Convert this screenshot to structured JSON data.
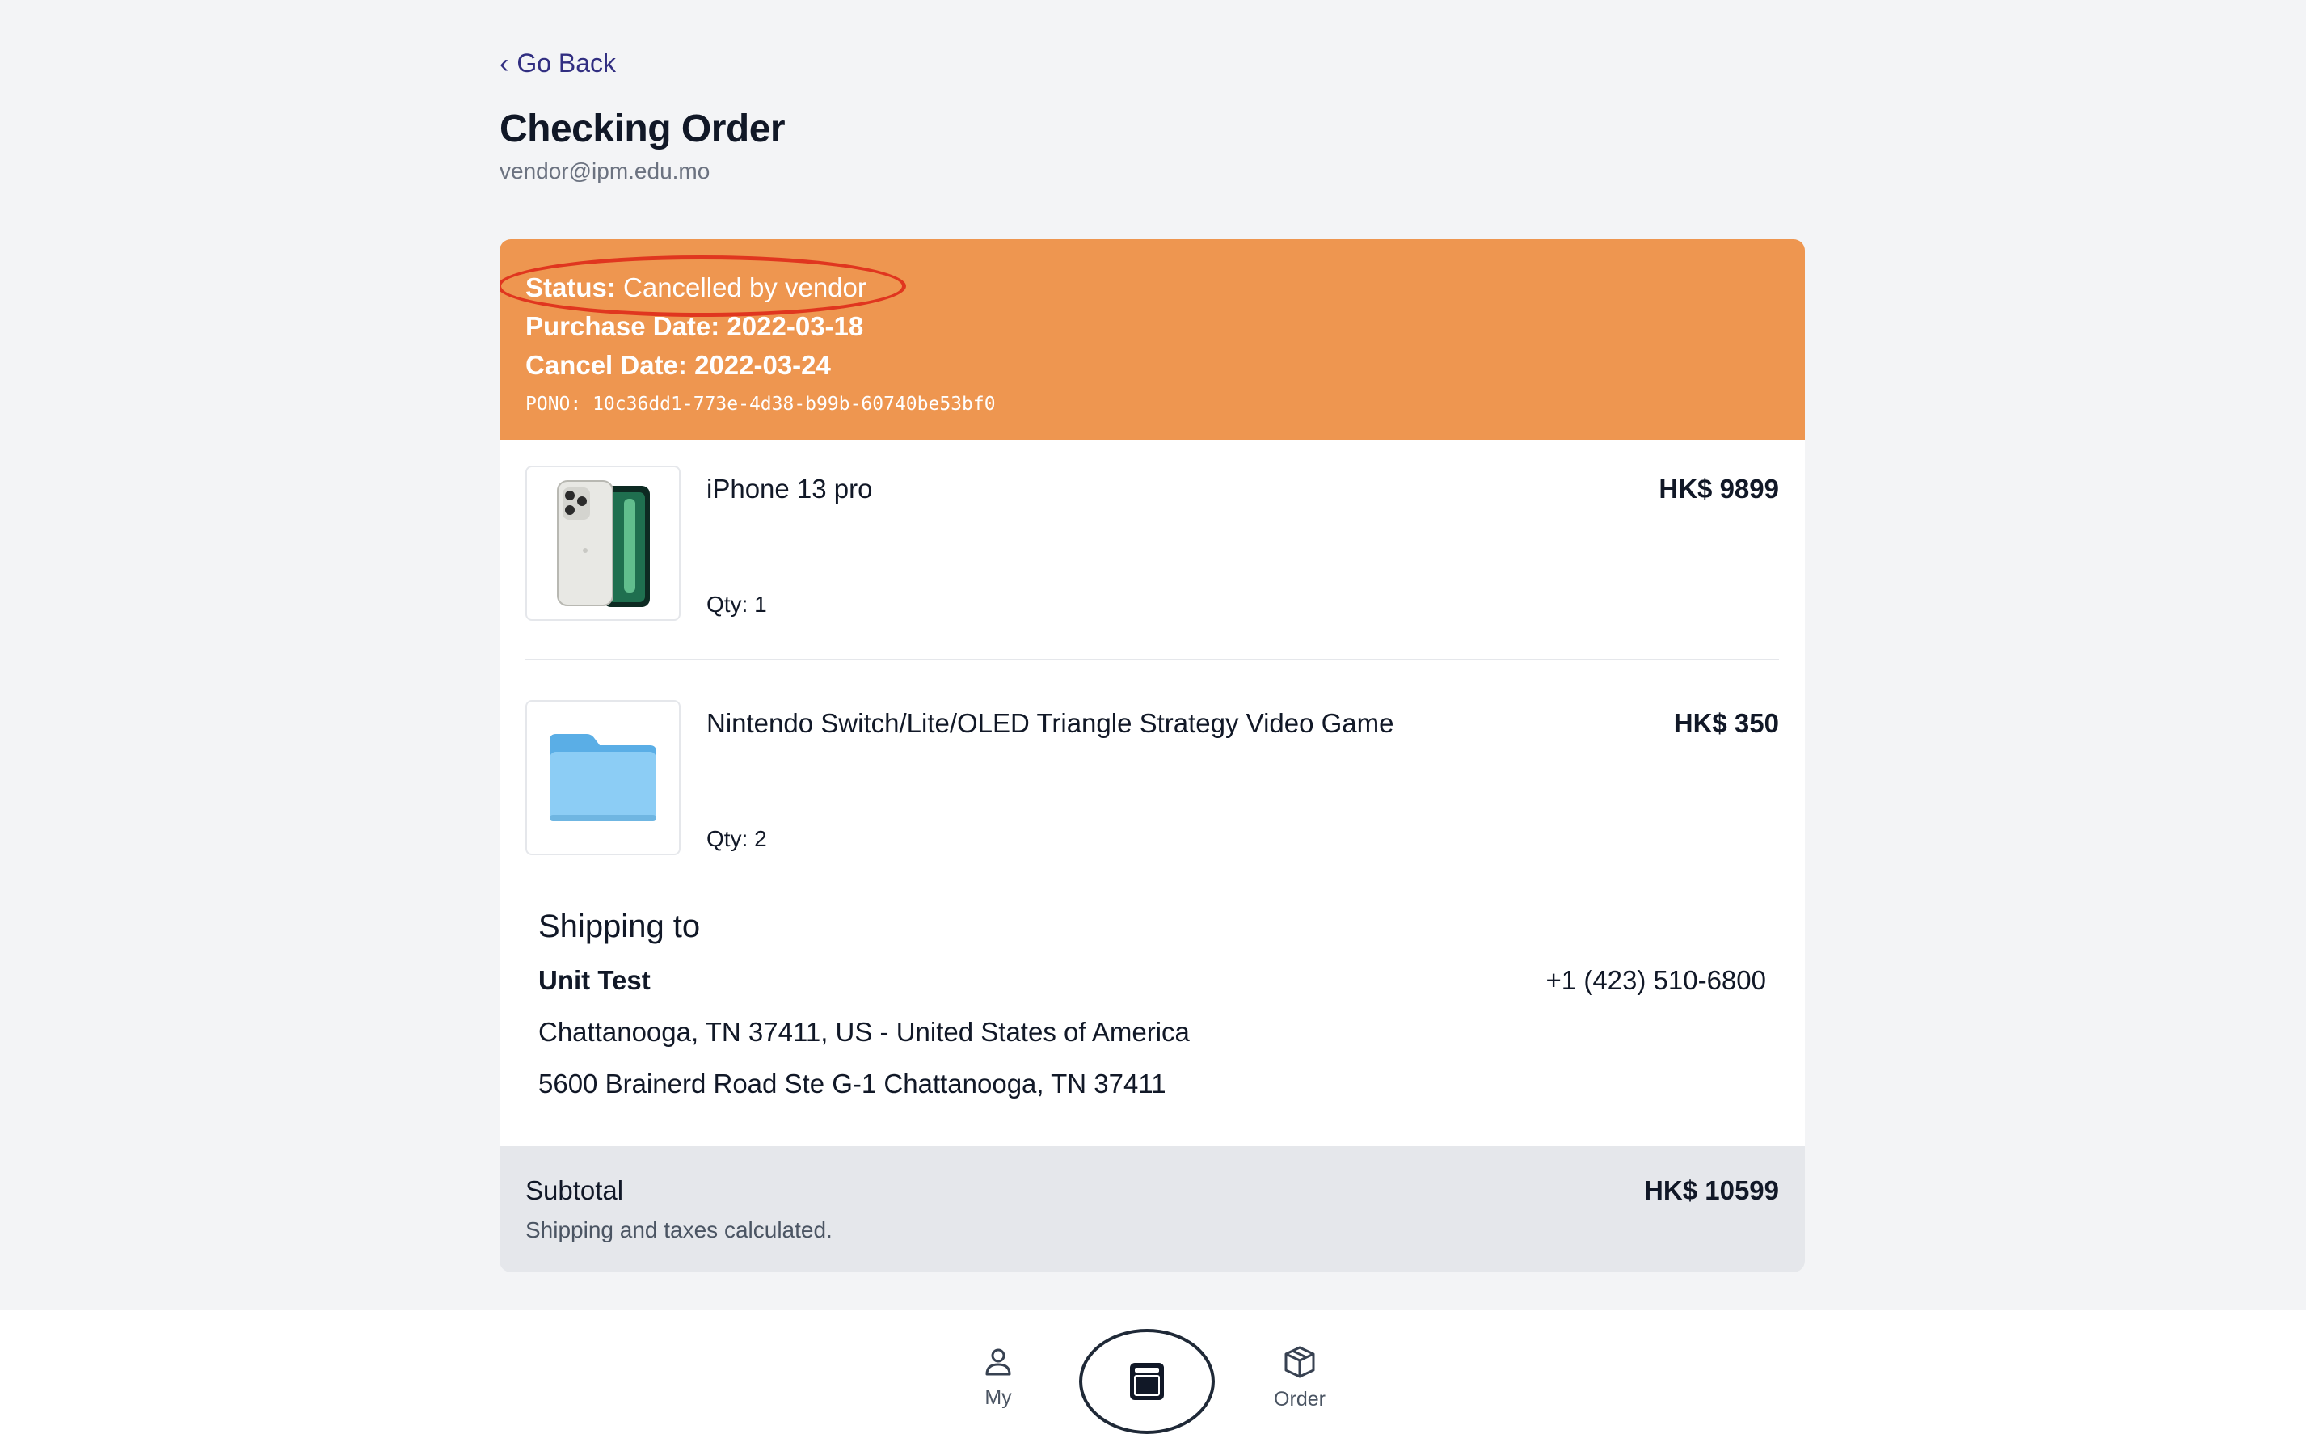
{
  "header": {
    "back_label": "Go Back",
    "title": "Checking Order",
    "email": "vendor@ipm.edu.mo"
  },
  "status": {
    "status_label": "Status:",
    "status_value": "Cancelled by vendor",
    "purchase_date": "Purchase Date: 2022-03-18",
    "cancel_date": "Cancel Date: 2022-03-24",
    "pono": "PONO: 10c36dd1-773e-4d38-b99b-60740be53bf0",
    "banner_color": "#ee9650",
    "highlight_color": "#e0361f"
  },
  "items": [
    {
      "name": "iPhone 13 pro",
      "price": "HK$ 9899",
      "qty": "Qty: 1",
      "image_icon": "iphone-image"
    },
    {
      "name": "Nintendo Switch/Lite/OLED Triangle Strategy Video Game",
      "price": "HK$ 350",
      "qty": "Qty: 2",
      "image_icon": "folder-icon"
    }
  ],
  "shipping": {
    "heading": "Shipping to",
    "name": "Unit Test",
    "phone": "+1 (423) 510-6800",
    "address_line1": "Chattanooga, TN 37411, US - United States of America",
    "address_line2": "5600 Brainerd Road Ste G-1 Chattanooga, TN 37411"
  },
  "subtotal": {
    "label": "Subtotal",
    "note": "Shipping and taxes calculated.",
    "amount": "HK$ 10599"
  },
  "nav": {
    "my_label": "My",
    "order_label": "Order",
    "my_icon": "user-icon",
    "center_icon": "book-icon",
    "order_icon": "box-icon"
  }
}
